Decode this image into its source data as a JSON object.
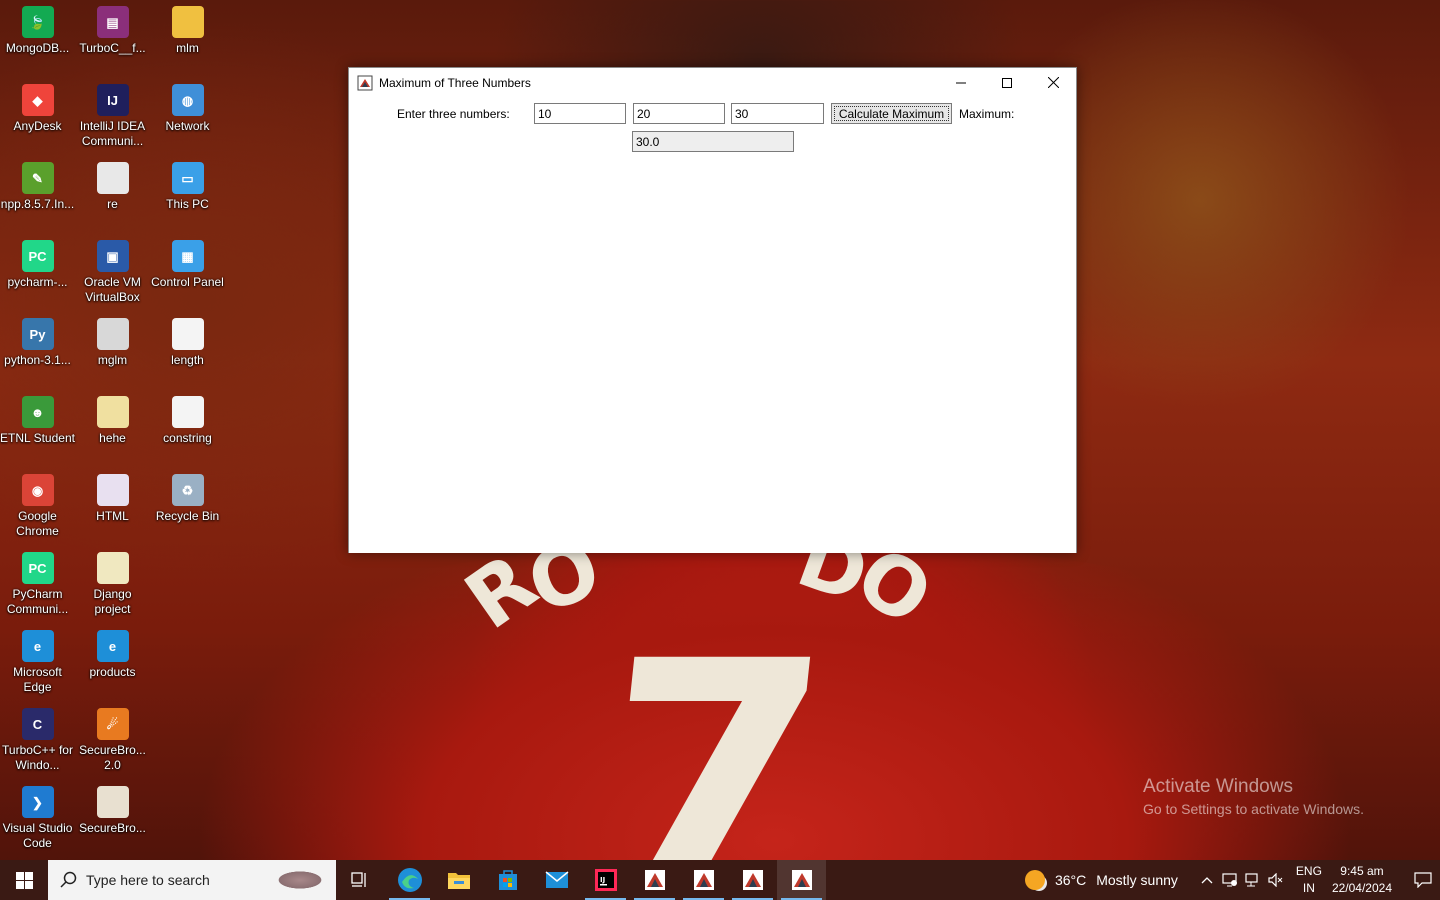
{
  "desktop": {
    "icons": [
      {
        "label": "MongoDB...",
        "icon": "mongodb-icon",
        "color": "#13aa52",
        "glyph": "🍃"
      },
      {
        "label": "TurboC__f...",
        "icon": "winrar-icon",
        "color": "#8b2f7a",
        "glyph": "▤"
      },
      {
        "label": "mlm",
        "icon": "folder-icon",
        "color": "#f0c040",
        "glyph": ""
      },
      {
        "label": "AnyDesk",
        "icon": "anydesk-icon",
        "color": "#ef443b",
        "glyph": "◆"
      },
      {
        "label": "IntelliJ IDEA Communi...",
        "icon": "intellij-icon",
        "color": "#1f1f5c",
        "glyph": "IJ"
      },
      {
        "label": "Network",
        "icon": "network-icon",
        "color": "#3f8fd8",
        "glyph": "◍"
      },
      {
        "label": "npp.8.5.7.In...",
        "icon": "notepadpp-installer-icon",
        "color": "#5aa02c",
        "glyph": "✎"
      },
      {
        "label": "re",
        "icon": "file-icon",
        "color": "#e8e8e8",
        "glyph": ""
      },
      {
        "label": "This PC",
        "icon": "this-pc-icon",
        "color": "#3aa0e8",
        "glyph": "▭"
      },
      {
        "label": "pycharm-...",
        "icon": "pycharm-installer-icon",
        "color": "#21d789",
        "glyph": "PC"
      },
      {
        "label": "Oracle VM VirtualBox",
        "icon": "virtualbox-icon",
        "color": "#2a5aa8",
        "glyph": "▣"
      },
      {
        "label": "Control Panel",
        "icon": "control-panel-icon",
        "color": "#3aa0e8",
        "glyph": "▦"
      },
      {
        "label": "python-3.1...",
        "icon": "python-installer-icon",
        "color": "#3776ab",
        "glyph": "Py"
      },
      {
        "label": "mglm",
        "icon": "file-icon",
        "color": "#d8d8d8",
        "glyph": ""
      },
      {
        "label": "length",
        "icon": "text-file-icon",
        "color": "#f4f4f4",
        "glyph": ""
      },
      {
        "label": "ETNL Student",
        "icon": "etnl-student-icon",
        "color": "#3a9a3a",
        "glyph": "☻"
      },
      {
        "label": "hehe",
        "icon": "file-icon",
        "color": "#f0e0a0",
        "glyph": ""
      },
      {
        "label": "constring",
        "icon": "text-file-icon",
        "color": "#f4f4f4",
        "glyph": ""
      },
      {
        "label": "Google Chrome",
        "icon": "chrome-icon",
        "color": "#db4437",
        "glyph": "◉"
      },
      {
        "label": "HTML",
        "icon": "file-icon",
        "color": "#e8e0f0",
        "glyph": ""
      },
      {
        "label": "Recycle Bin",
        "icon": "recycle-bin-icon",
        "color": "#9ab0c4",
        "glyph": "♻"
      },
      {
        "label": "PyCharm Communi...",
        "icon": "pycharm-icon",
        "color": "#21d789",
        "glyph": "PC"
      },
      {
        "label": "Django project",
        "icon": "file-icon",
        "color": "#f0e8c0",
        "glyph": ""
      },
      {
        "label": "Microsoft Edge",
        "icon": "edge-icon",
        "color": "#1e8fd8",
        "glyph": "e"
      },
      {
        "label": "products",
        "icon": "edge-document-icon",
        "color": "#1e8fd8",
        "glyph": "e"
      },
      {
        "label": "TurboC++ for Windo...",
        "icon": "turbocpp-icon",
        "color": "#2a2a6a",
        "glyph": "C"
      },
      {
        "label": "SecureBro... 2.0",
        "icon": "securebrowser-icon",
        "color": "#e87a20",
        "glyph": "☄"
      },
      {
        "label": "Visual Studio Code",
        "icon": "vscode-icon",
        "color": "#1f7bd1",
        "glyph": "❯"
      },
      {
        "label": "SecureBro...",
        "icon": "file-icon",
        "color": "#e8e0d0",
        "glyph": ""
      }
    ]
  },
  "window": {
    "title": "Maximum of Three Numbers",
    "form": {
      "prompt_label": "Enter three numbers:",
      "num1": "10",
      "num2": "20",
      "num3": "30",
      "calculate_label": "Calculate Maximum",
      "result_label": "Maximum:",
      "result_value": "30.0"
    }
  },
  "watermark": {
    "line1": "Activate Windows",
    "line2": "Go to Settings to activate Windows."
  },
  "taskbar": {
    "search_placeholder": "Type here to search",
    "weather_temp": "36°C",
    "weather_desc": "Mostly sunny",
    "lang_line1": "ENG",
    "lang_line2": "IN",
    "time": "9:45 am",
    "date": "22/04/2024"
  }
}
